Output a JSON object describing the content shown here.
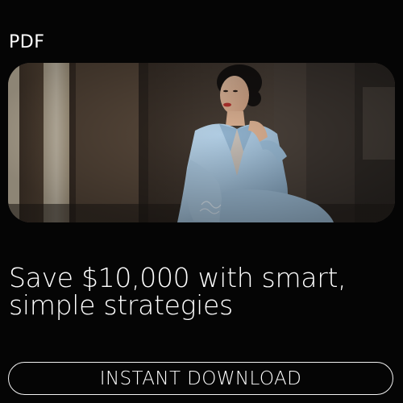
{
  "header": {
    "format_label": "PDF"
  },
  "hero": {
    "image_subject": "woman-in-light-blue-suit-photo"
  },
  "headline": {
    "line1": "Save $10,000 with smart,",
    "line2": "simple strategies"
  },
  "cta": {
    "label": "INSTANT DOWNLOAD"
  },
  "colors": {
    "background": "#050505",
    "text": "#ffffff",
    "suit": "#a9c7df",
    "button_border": "#f2f2f2"
  }
}
